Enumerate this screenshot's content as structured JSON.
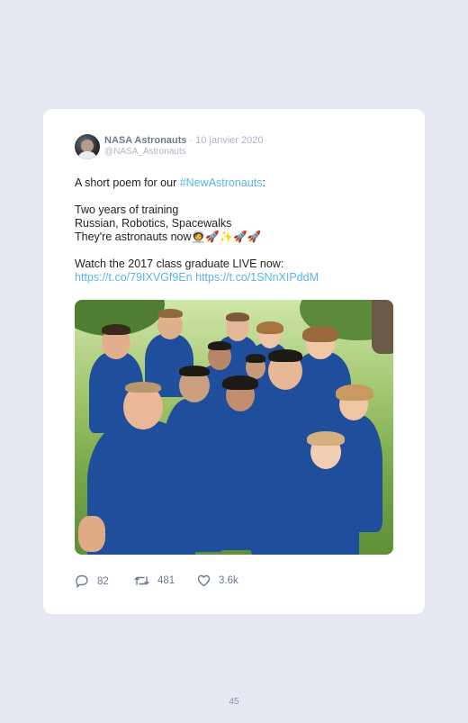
{
  "tweet": {
    "author_name": "NASA Astronauts",
    "separator": " · ",
    "date": "10 janvier 2020",
    "handle": "@NASA_Astronauts",
    "line1_prefix": "A short poem for our ",
    "hashtag": "#NewAstronauts",
    "line1_suffix": ":",
    "line2": "Two years of training",
    "line3": "Russian, Robotics, Spacewalks",
    "line4": "They're astronauts now🧑‍🚀🚀✨🚀🚀",
    "line5": "Watch the 2017 class graduate LIVE now:",
    "link1": "https://t.co/79IXVGf9En",
    "link2": "https://t.co/1SNnXIPddM"
  },
  "actions": {
    "replies": "82",
    "retweets": "481",
    "likes": "3.6k"
  },
  "page_number": "45"
}
